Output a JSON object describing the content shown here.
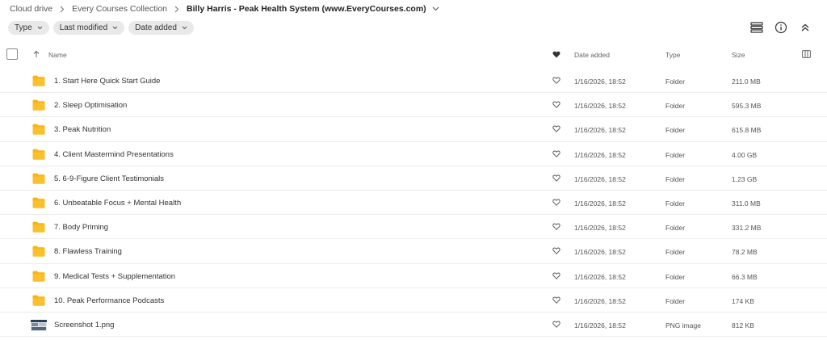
{
  "breadcrumb": {
    "items": [
      "Cloud drive",
      "Every Courses Collection"
    ],
    "current": "Billy Harris - Peak Health System (www.EveryCourses.com)"
  },
  "filters": [
    "Type",
    "Last modified",
    "Date added"
  ],
  "columns": {
    "name": "Name",
    "date_added": "Date added",
    "type": "Type",
    "size": "Size"
  },
  "rows": [
    {
      "name": "1. Start Here Quick Start Guide",
      "date": "1/16/2026, 18:52",
      "type": "Folder",
      "size": "211.0 MB",
      "icon": "folder-icon"
    },
    {
      "name": "2. Sleep Optimisation",
      "date": "1/16/2026, 18:52",
      "type": "Folder",
      "size": "595.3 MB",
      "icon": "folder-icon"
    },
    {
      "name": "3. Peak Nutrition",
      "date": "1/16/2026, 18:52",
      "type": "Folder",
      "size": "615.8 MB",
      "icon": "folder-icon"
    },
    {
      "name": "4. Client Mastermind Presentations",
      "date": "1/16/2026, 18:52",
      "type": "Folder",
      "size": "4.00 GB",
      "icon": "folder-icon"
    },
    {
      "name": "5. 6-9-Figure Client Testimonials",
      "date": "1/16/2026, 18:52",
      "type": "Folder",
      "size": "1.23 GB",
      "icon": "folder-icon"
    },
    {
      "name": "6. Unbeatable Focus + Mental Health",
      "date": "1/16/2026, 18:52",
      "type": "Folder",
      "size": "311.0 MB",
      "icon": "folder-icon"
    },
    {
      "name": "7. Body Priming",
      "date": "1/16/2026, 18:52",
      "type": "Folder",
      "size": "331.2 MB",
      "icon": "folder-icon"
    },
    {
      "name": "8. Flawless Training",
      "date": "1/16/2026, 18:52",
      "type": "Folder",
      "size": "78.2 MB",
      "icon": "folder-icon"
    },
    {
      "name": "9. Medical Tests + Supplementation",
      "date": "1/16/2026, 18:52",
      "type": "Folder",
      "size": "66.3 MB",
      "icon": "folder-icon"
    },
    {
      "name": "10. Peak Performance Podcasts",
      "date": "1/16/2026, 18:52",
      "type": "Folder",
      "size": "174 KB",
      "icon": "folder-icon"
    },
    {
      "name": "Screenshot 1.png",
      "date": "1/16/2026, 18:52",
      "type": "PNG image",
      "size": "812 KB",
      "icon": "image-thumbnail-icon"
    }
  ],
  "colors": {
    "folder": "#f9b413",
    "chip_bg": "#e9e9e9",
    "row_border": "#ececec",
    "text": "#303233"
  }
}
